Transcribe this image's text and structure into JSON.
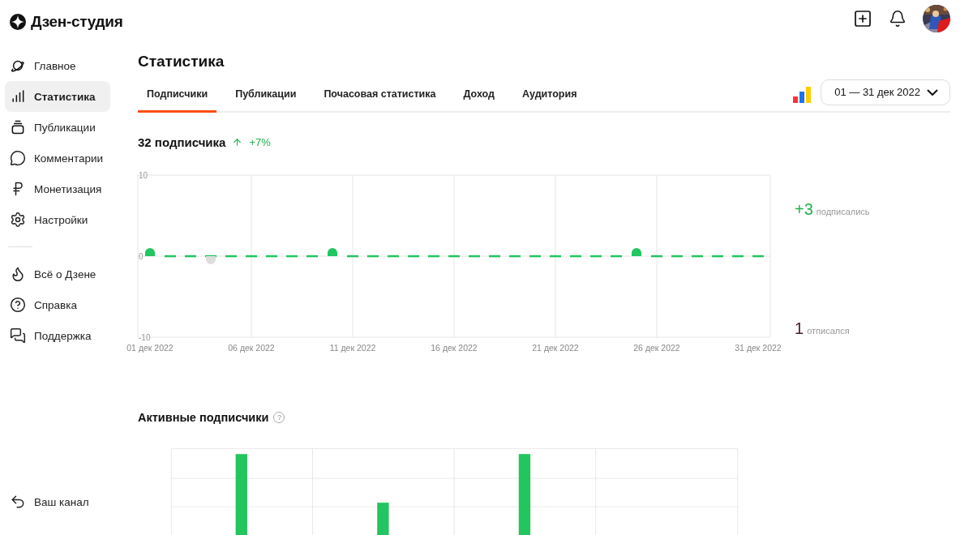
{
  "logo": {
    "text": "Дзен-студия"
  },
  "sidebar": {
    "main": [
      {
        "label": "Главное",
        "selected": false
      },
      {
        "label": "Статистика",
        "selected": true
      },
      {
        "label": "Публикации",
        "selected": false
      },
      {
        "label": "Комментарии",
        "selected": false
      },
      {
        "label": "Монетизация",
        "selected": false
      },
      {
        "label": "Настройки",
        "selected": false
      }
    ],
    "secondary": [
      {
        "label": "Всё о Дзене",
        "selected": false
      },
      {
        "label": "Справка",
        "selected": false
      },
      {
        "label": "Поддержка",
        "selected": false
      }
    ],
    "footer": {
      "label": "Ваш канал"
    }
  },
  "page": {
    "title": "Статистика"
  },
  "tabs": [
    {
      "label": "Подписчики",
      "selected": true
    },
    {
      "label": "Публикации",
      "selected": false
    },
    {
      "label": "Почасовая статистика",
      "selected": false
    },
    {
      "label": "Доход",
      "selected": false
    },
    {
      "label": "Аудитория",
      "selected": false
    }
  ],
  "date_range": "01 — 31 дек 2022",
  "subscribers": {
    "count": "32 подписчика",
    "change": "+7%",
    "chart_data": {
      "type": "bar",
      "categories": [
        "01 дек 2022",
        null,
        null,
        null,
        null,
        "06 дек 2022",
        null,
        null,
        null,
        null,
        "11 дек 2022",
        null,
        null,
        null,
        null,
        "16 дек 2022",
        null,
        null,
        null,
        null,
        "21 дек 2022",
        null,
        null,
        null,
        null,
        "26 дек 2022",
        null,
        null,
        null,
        null,
        "31 дек 2022"
      ],
      "ylim": [
        -10,
        10
      ],
      "yticks": [
        10,
        0,
        -10
      ],
      "grid": true,
      "series": [
        {
          "color": "#22c55e",
          "values": [
            1,
            0,
            0,
            0,
            0,
            0,
            0,
            0,
            0,
            1,
            0,
            0,
            0,
            0,
            0,
            0,
            0,
            0,
            0,
            0,
            0,
            0,
            0,
            0,
            1,
            0,
            0,
            0,
            0,
            0,
            0
          ]
        },
        {
          "color": "#dddddd",
          "values": [
            0,
            0,
            0,
            -1,
            0,
            0,
            0,
            0,
            0,
            0,
            0,
            0,
            0,
            0,
            0,
            0,
            0,
            0,
            0,
            0,
            0,
            0,
            0,
            0,
            0,
            0,
            0,
            0,
            0,
            0,
            0
          ]
        }
      ]
    },
    "subscribed": {
      "value": "+3",
      "label": "подписались"
    },
    "unsubscribed": {
      "value": "1",
      "label": "отписался"
    }
  },
  "active": {
    "title": "Активные подписчики",
    "help": "?"
  }
}
